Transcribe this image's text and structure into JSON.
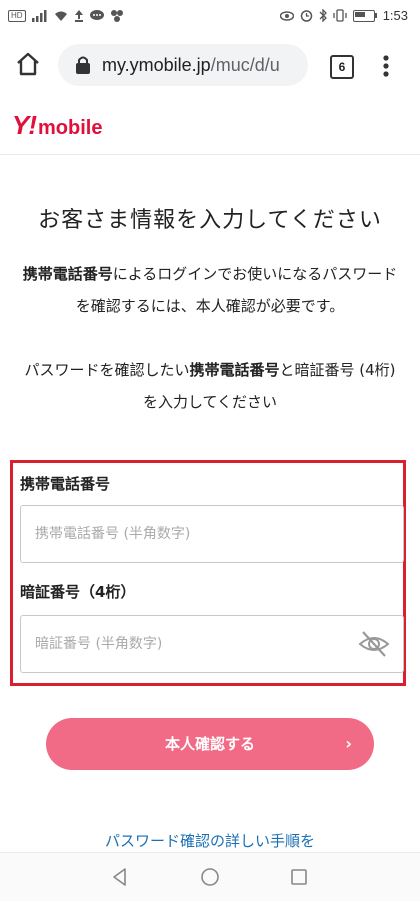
{
  "status_bar": {
    "hd_badge": "HD",
    "time": "1:53",
    "left_icons": [
      "signal-icon",
      "wifi-icon",
      "upload-icon",
      "chat-icon",
      "app-icon"
    ],
    "right_icons": [
      "eye-icon",
      "alarm-icon",
      "bluetooth-icon",
      "vibrate-icon",
      "battery-icon"
    ]
  },
  "browser": {
    "url_host": "my.ymobile.jp",
    "url_path": "/muc/d/u",
    "tab_count": "6"
  },
  "site": {
    "logo_y": "Y!",
    "logo_text": "mobile",
    "brand_color": "#e0103a"
  },
  "page": {
    "title": "お客さま情報を入力してください",
    "desc_bold": "携帯電話番号",
    "desc_rest": "によるログインでお使いになるパスワードを確認するには、本人確認が必要です。",
    "desc2_pre": "パスワードを確認したい",
    "desc2_bold": "携帯電話番号",
    "desc2_post": "と暗証番号 (4桁) を入力してください"
  },
  "form": {
    "phone_label": "携帯電話番号",
    "phone_placeholder": "携帯電話番号 (半角数字)",
    "phone_value": "",
    "pin_label": "暗証番号（4桁）",
    "pin_placeholder": "暗証番号 (半角数字)",
    "pin_value": "",
    "highlight_color": "#d8202f"
  },
  "submit": {
    "label": "本人確認する",
    "chevron": "›",
    "color": "#f26b86"
  },
  "help": {
    "link_text": "パスワード確認の詳しい手順を",
    "color": "#1a6fb5"
  }
}
